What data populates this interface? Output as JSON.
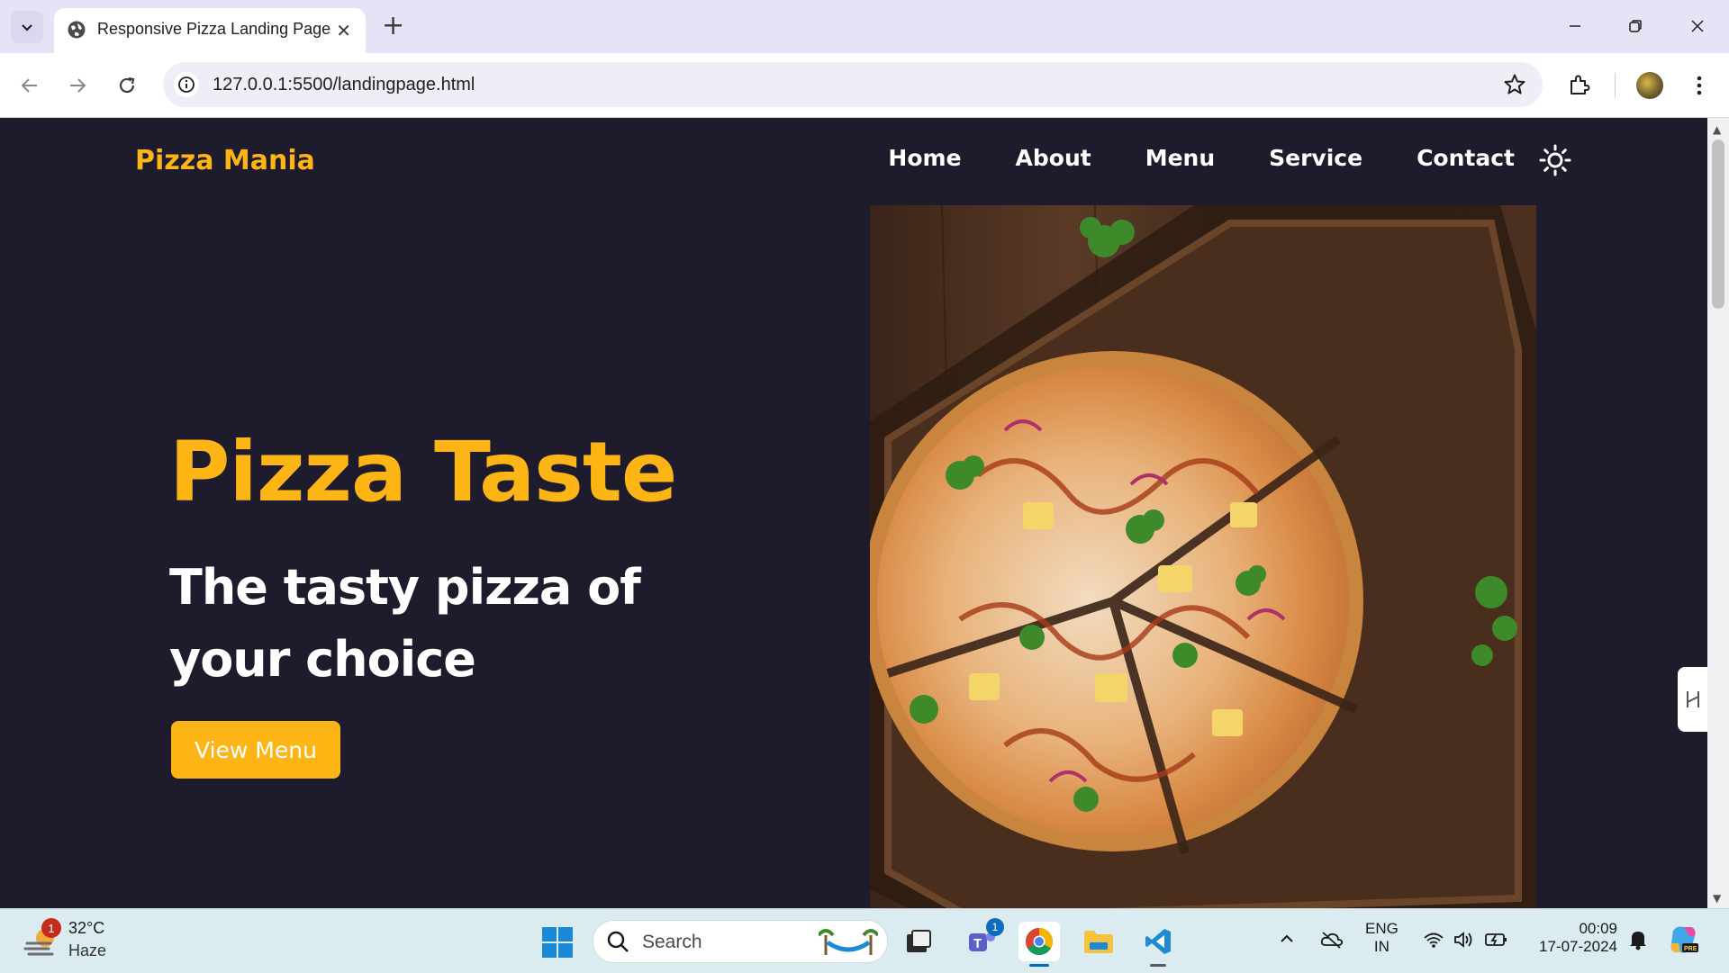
{
  "browser": {
    "tab_title": "Responsive Pizza Landing Page",
    "url": "127.0.0.1:5500/landingpage.html",
    "icons": [
      "tab-search-icon",
      "globe-icon",
      "close-icon",
      "plus-icon",
      "minimize-icon",
      "restore-icon",
      "window-close-icon",
      "back-icon",
      "forward-icon",
      "reload-icon",
      "site-info-icon",
      "star-icon",
      "extensions-icon",
      "profile-avatar",
      "more-icon"
    ]
  },
  "page": {
    "logo": "Pizza Mania",
    "nav": [
      "Home",
      "About",
      "Menu",
      "Service",
      "Contact"
    ],
    "hero_title": "Pizza Taste",
    "hero_subtitle": "The tasty pizza of your choice",
    "cta_label": "View Menu",
    "colors": {
      "accent": "#fcb514",
      "background": "#1e1b2c",
      "text": "#ffffff"
    }
  },
  "taskbar": {
    "weather_badge": "1",
    "weather_temp": "32°C",
    "weather_desc": "Haze",
    "search_placeholder": "Search",
    "teams_badge": "1",
    "lang_top": "ENG",
    "lang_bottom": "IN",
    "time": "00:09",
    "date": "17-07-2024"
  }
}
